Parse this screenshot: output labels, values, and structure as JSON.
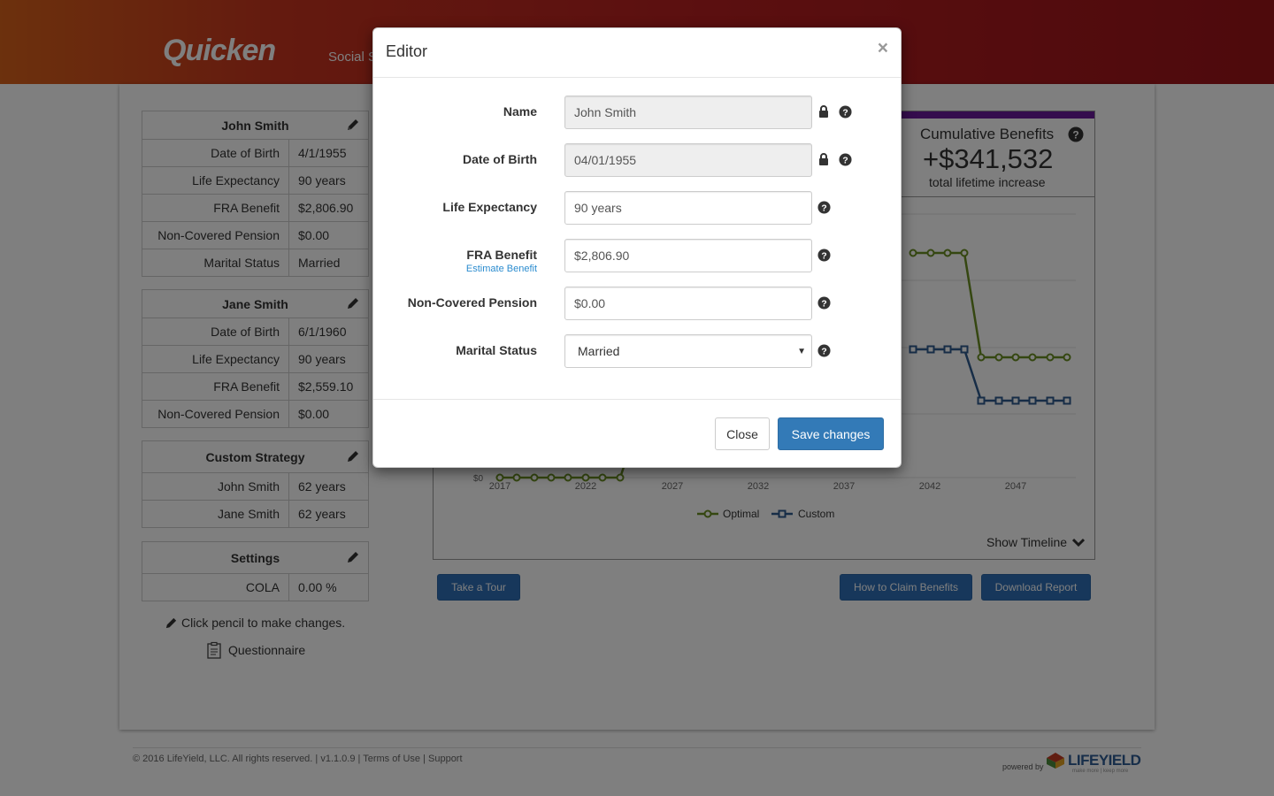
{
  "header": {
    "logo": "Quicken",
    "nav_text": "Social S"
  },
  "people": [
    {
      "name": "John Smith",
      "rows": [
        {
          "label": "Date of Birth",
          "value": "4/1/1955"
        },
        {
          "label": "Life Expectancy",
          "value": "90 years"
        },
        {
          "label": "FRA Benefit",
          "value": "$2,806.90"
        },
        {
          "label": "Non-Covered Pension",
          "value": "$0.00"
        },
        {
          "label": "Marital Status",
          "value": "Married"
        }
      ]
    },
    {
      "name": "Jane Smith",
      "rows": [
        {
          "label": "Date of Birth",
          "value": "6/1/1960"
        },
        {
          "label": "Life Expectancy",
          "value": "90 years"
        },
        {
          "label": "FRA Benefit",
          "value": "$2,559.10"
        },
        {
          "label": "Non-Covered Pension",
          "value": "$0.00"
        }
      ]
    }
  ],
  "strategy": {
    "title": "Custom Strategy",
    "rows": [
      {
        "label": "John Smith",
        "value": "62 years"
      },
      {
        "label": "Jane Smith",
        "value": "62 years"
      }
    ]
  },
  "settings": {
    "title": "Settings",
    "rows": [
      {
        "label": "COLA",
        "value": "0.00 %"
      }
    ]
  },
  "hint": "Click pencil to make changes.",
  "questionnaire": "Questionnaire",
  "cumulative": {
    "title": "Cumulative Benefits",
    "value": "+$341,532",
    "subtitle": "total lifetime increase"
  },
  "chart_data": {
    "type": "line",
    "x_ticks": [
      "2017",
      "2022",
      "2027",
      "2032",
      "2037",
      "2042",
      "2047"
    ],
    "y_ticks": [
      "$0"
    ],
    "legend": [
      "Optimal",
      "Custom"
    ],
    "colors": {
      "optimal": "#6b8e23",
      "custom": "#2f5b8f"
    },
    "series": [
      {
        "name": "Optimal",
        "x": [
          2017,
          2018,
          2019,
          2020,
          2021,
          2022,
          2023,
          2024
        ],
        "note_visible": "$0 segment"
      },
      {
        "name": "Custom"
      }
    ]
  },
  "show_timeline": "Show Timeline",
  "buttons": {
    "tour": "Take a Tour",
    "claim": "How to Claim Benefits",
    "download": "Download Report"
  },
  "footer": {
    "copyright": "© 2016 LifeYield, LLC. All rights reserved. | v1.1.0.9 | Terms of Use | Support",
    "powered_by": "powered by",
    "brand": "LIFEYIELD",
    "tagline": "make more | keep more"
  },
  "modal": {
    "title": "Editor",
    "close_x": "×",
    "fields": {
      "name": {
        "label": "Name",
        "value": "John Smith"
      },
      "dob": {
        "label": "Date of Birth",
        "value": "04/01/1955"
      },
      "life": {
        "label": "Life Expectancy",
        "value": "90 years"
      },
      "fra": {
        "label": "FRA Benefit",
        "sub": "Estimate Benefit",
        "value": "$2,806.90"
      },
      "pension": {
        "label": "Non-Covered Pension",
        "value": "$0.00"
      },
      "marital": {
        "label": "Marital Status",
        "value": "Married"
      }
    },
    "close_label": "Close",
    "save_label": "Save changes"
  }
}
